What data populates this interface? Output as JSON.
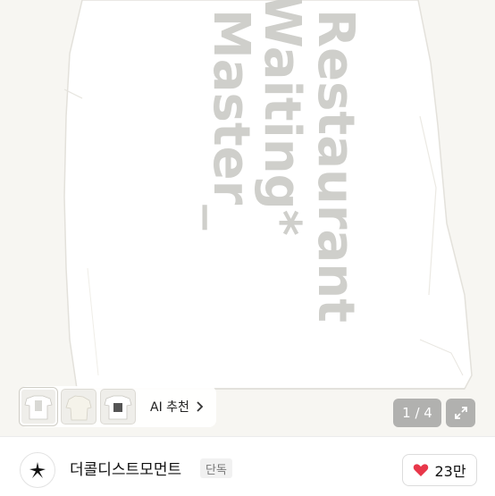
{
  "product_image": {
    "print_lines": [
      "Restaurant",
      "Waiting*",
      "Master_"
    ]
  },
  "thumbnails": {
    "ai_label": "AI 추천",
    "chevron_icon": "chevron-right-icon"
  },
  "gallery": {
    "counter": "1 / 4",
    "expand_icon": "expand-icon"
  },
  "store": {
    "name": "더콜디스트모먼트",
    "badge": "단독",
    "like_count": "23만",
    "heart_color": "#e8374a"
  }
}
